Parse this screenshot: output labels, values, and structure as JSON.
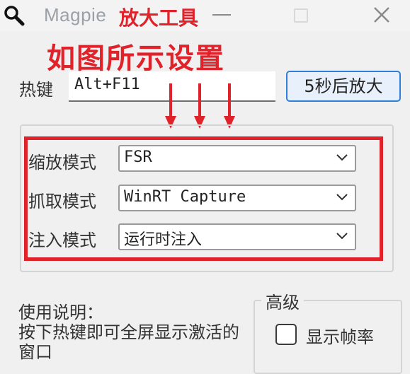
{
  "window": {
    "title": "Magpie",
    "subtitle": "放大工具",
    "icon": "magnifier-icon"
  },
  "annotation": {
    "text": "如图所示设置",
    "color": "#e0222b"
  },
  "hotkey": {
    "label": "热键",
    "value": "Alt+F11"
  },
  "action_button": {
    "label": "5秒后放大"
  },
  "settings": {
    "scale_mode": {
      "label": "缩放模式",
      "value": "FSR"
    },
    "capture_mode": {
      "label": "抓取模式",
      "value": "WinRT Capture"
    },
    "inject_mode": {
      "label": "注入模式",
      "value": "运行时注入"
    }
  },
  "usage": {
    "text": "使用说明：\n按下热键即可全屏显示激活的窗口"
  },
  "advanced": {
    "title": "高级",
    "show_fps_label": "显示帧率",
    "show_fps_checked": false
  },
  "colors": {
    "accent_blue": "#2f7fd8",
    "highlight_red": "#e0222b"
  }
}
